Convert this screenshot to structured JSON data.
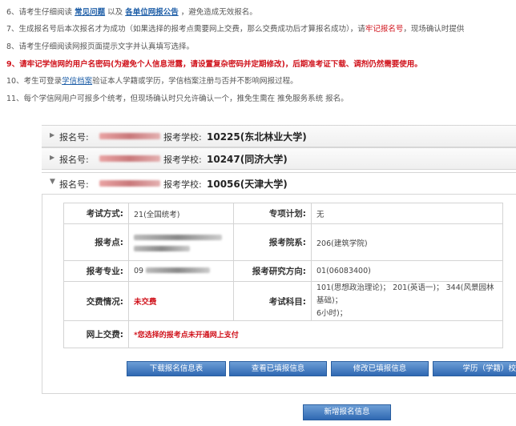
{
  "notes": {
    "n6": {
      "num": "6、",
      "pre": "请考生仔细阅读",
      "link1": "常见问题",
      "mid": "以及",
      "link2": "各单位网报公告",
      "post": "，避免造成无效报名。"
    },
    "n7": {
      "num": "7、",
      "pre": "生成报名号后本次报名才为成功（如果选择的报考点需要网上交费，那么交费成功后才算报名成功），请",
      "red": "牢记报名号",
      "post": "，现场确认时提供"
    },
    "n8": {
      "text": "8、请考生仔细阅读网报页面提示文字并认真填写选择。"
    },
    "n9": {
      "text": "9、请牢记学信网的用户名密码(为避免个人信息泄露，请设置复杂密码并定期修改)，后期准考证下载、调剂仍然需要使用。"
    },
    "n10": {
      "pre": "10、考生可登录",
      "link": "学信档案",
      "post": "验证本人学籍或学历，学信档案注册与否并不影响网报过程。"
    },
    "n11": {
      "text": "11、每个学信网用户可报多个统考，但现场确认时只允许确认一个，推免生需在  推免服务系统  报名。"
    }
  },
  "applications": [
    {
      "label": "报名号:",
      "school_label": "报考学校:",
      "school": "10225(东北林业大学)",
      "expanded": false
    },
    {
      "label": "报名号:",
      "school_label": "报考学校:",
      "school": "10247(同济大学)",
      "expanded": false
    },
    {
      "label": "报名号:",
      "school_label": "报考学校:",
      "school": "10056(天津大学)",
      "expanded": true
    }
  ],
  "detail": {
    "exam_mode_label": "考试方式:",
    "exam_mode": "21(全国统考)",
    "special_plan_label": "专项计划:",
    "special_plan": "无",
    "exam_site_label": "报考点:",
    "department_label": "报考院系:",
    "department": "206(建筑学院)",
    "major_label": "报考专业:",
    "major_prefix": "09",
    "direction_label": "报考研究方向:",
    "direction": "01(06083400)",
    "payment_label": "交费情况:",
    "payment": "未交费",
    "subjects_label": "考试科目:",
    "subjects_line1": "101(思想政治理论)； 201(英语一)； 344(风景园林基础)；",
    "subjects_line2": "6小时)；",
    "online_pay_label": "网上交费:",
    "online_pay": "*您选择的报考点未开通网上支付"
  },
  "buttons": {
    "download": "下载报名信息表",
    "view": "查看已填报信息",
    "modify": "修改已填报信息",
    "degree": "学历（学籍）校",
    "add": "新增报名信息"
  },
  "colors": {
    "link": "#1f5fa8",
    "warning": "#d0121b",
    "button": "#2f68b2"
  }
}
